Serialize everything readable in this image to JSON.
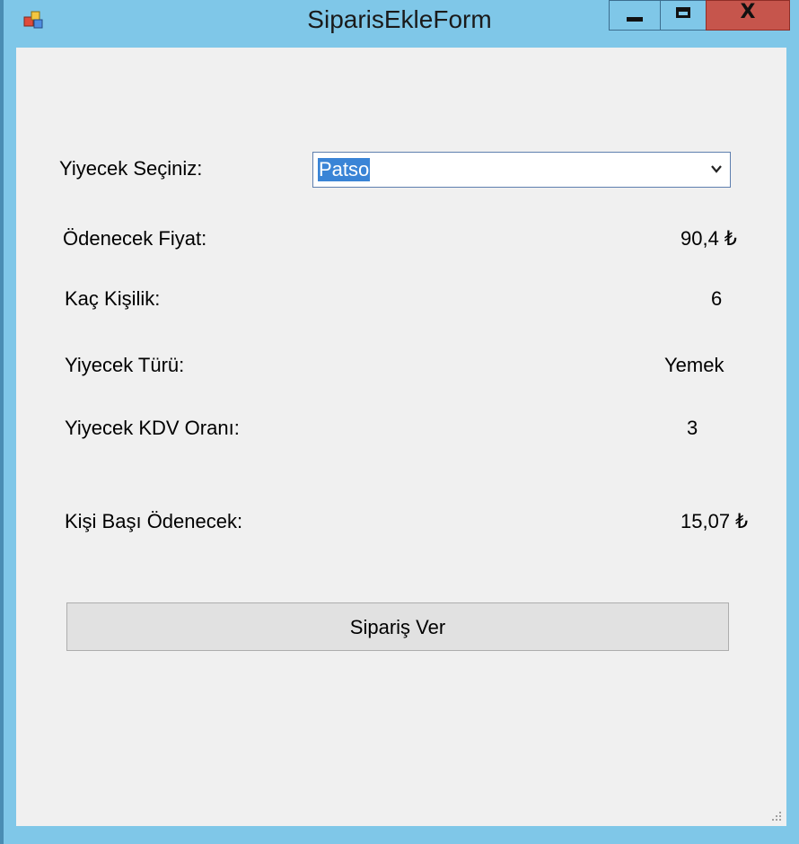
{
  "window": {
    "title": "SiparisEkleForm",
    "controls": {
      "minimize_icon": "minimize-icon",
      "maximize_icon": "maximize-icon",
      "close_label": "X"
    }
  },
  "form": {
    "food_select": {
      "label": "Yiyecek Seçiniz:",
      "value": "Patso"
    },
    "fields": [
      {
        "label": "Ödenecek Fiyat:",
        "value": "90,4 ₺"
      },
      {
        "label": "Kaç Kişilik:",
        "value": "6"
      },
      {
        "label": "Yiyecek Türü:",
        "value": "Yemek"
      },
      {
        "label": "Yiyecek KDV Oranı:",
        "value": "3"
      },
      {
        "label": "Kişi Başı Ödenecek:",
        "value": "15,07 ₺"
      }
    ],
    "submit_label": "Sipariş Ver"
  },
  "colors": {
    "title_bar": "#7fc7e8",
    "close_button": "#c6554c",
    "client_background": "#f0f0f0",
    "selection": "#3a84d6"
  }
}
